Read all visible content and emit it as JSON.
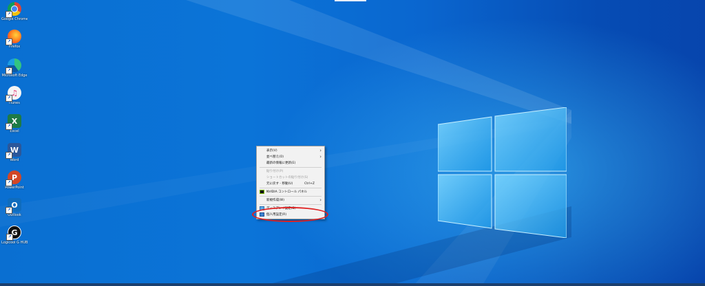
{
  "desktop": {
    "icons": [
      {
        "label": "Google Chrome",
        "icon": "chrome-icon",
        "glyph": "",
        "color": "#e23a2e"
      },
      {
        "label": "Firefox",
        "icon": "firefox-icon",
        "glyph": "",
        "color": "#ff7a1a"
      },
      {
        "label": "Microsoft Edge",
        "icon": "edge-icon",
        "glyph": "",
        "color": "#1aa37f"
      },
      {
        "label": "iTunes",
        "icon": "itunes-icon",
        "glyph": "♫",
        "color": "#f5f5f5"
      },
      {
        "label": "Excel",
        "icon": "excel-icon",
        "glyph": "X",
        "color": "#1e7a45"
      },
      {
        "label": "Word",
        "icon": "word-icon",
        "glyph": "W",
        "color": "#2b579a"
      },
      {
        "label": "PowerPoint",
        "icon": "powerpoint-icon",
        "glyph": "P",
        "color": "#d24726"
      },
      {
        "label": "Outlook",
        "icon": "outlook-icon",
        "glyph": "O",
        "color": "#0f6cbd"
      },
      {
        "label": "Logicool G HUB",
        "icon": "logitech-g-icon",
        "glyph": "G",
        "color": "#111111"
      }
    ]
  },
  "context_menu": {
    "items": [
      {
        "label": "表示(V)",
        "submenu": true,
        "disabled": false
      },
      {
        "label": "並べ替え(O)",
        "submenu": true,
        "disabled": false
      },
      {
        "label": "最新の情報に更新(E)",
        "submenu": false,
        "disabled": false
      },
      {
        "label": "貼り付け(P)",
        "submenu": false,
        "disabled": true
      },
      {
        "label": "ショートカットの貼り付け(S)",
        "submenu": false,
        "disabled": true
      },
      {
        "label": "元に戻す - 移動(U)",
        "shortcut": "Ctrl+Z",
        "submenu": false,
        "disabled": false
      },
      {
        "label": "NVIDIA コントロール パネル",
        "submenu": false,
        "disabled": false
      },
      {
        "label": "新規作成(W)",
        "submenu": true,
        "disabled": false
      },
      {
        "label": "ディスプレイ設定(D)",
        "submenu": false,
        "disabled": false
      },
      {
        "label": "個人用設定(R)",
        "submenu": false,
        "disabled": false
      }
    ],
    "submenu_glyph": "›"
  },
  "colors": {
    "highlight": "#e02020",
    "nvidia": "#76b900"
  }
}
